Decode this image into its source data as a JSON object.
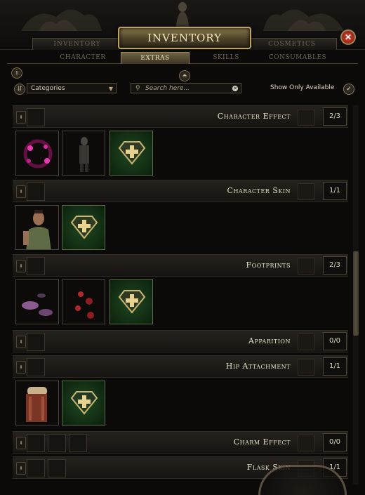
{
  "header": {
    "title": "Inventory",
    "left_tab": "Inventory",
    "right_tab": "Cosmetics",
    "close_symbol": "✕"
  },
  "subtabs": [
    "Character",
    "Extras",
    "Skills",
    "Consumables"
  ],
  "active_subtab": "Extras",
  "toolbar": {
    "info_symbol": "i",
    "collapse_symbol": "⏶",
    "sort_symbol": "⇵",
    "categories_value": "Categories",
    "categories_arrow": "▼",
    "search_placeholder": "Search here...",
    "search_icon": "⚲",
    "clear_symbol": "✕",
    "show_only_available_label": "Show Only Available",
    "toggle_symbol": "✓"
  },
  "categories": [
    {
      "name": "Character Effect",
      "count": "2/3",
      "items": [
        "crimson-vortex-effect",
        "dark-figure-effect",
        "add-new"
      ]
    },
    {
      "name": "Character Skin",
      "count": "1/1",
      "items": [
        "tribal-warrior-skin",
        "add-new"
      ]
    },
    {
      "name": "Footprints",
      "count": "2/3",
      "items": [
        "purple-splash-footprints",
        "red-blood-footprints",
        "add-new"
      ]
    },
    {
      "name": "Apparition",
      "count": "0/0",
      "items": []
    },
    {
      "name": "Hip Attachment",
      "count": "1/1",
      "items": [
        "backpack-attachment",
        "add-new"
      ]
    },
    {
      "name": "Charm Effect",
      "count": "0/0",
      "items": []
    },
    {
      "name": "Flask Skin",
      "count": "1/1",
      "items": []
    }
  ],
  "colors": {
    "gold": "#b9a468",
    "add_slot_green": "#1f4a20",
    "close_red": "#d8442e"
  }
}
